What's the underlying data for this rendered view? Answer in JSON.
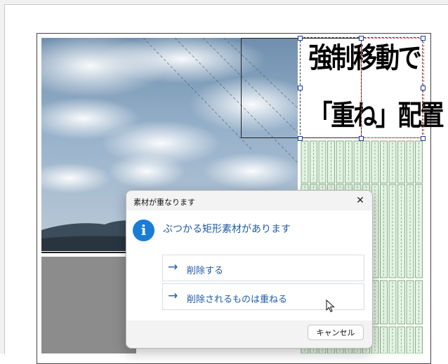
{
  "canvas": {
    "title_lines": [
      "強制移動で",
      "「重ね」配置"
    ]
  },
  "dialog": {
    "title": "素材が重なります",
    "message": "ぶつかる矩形素材があります",
    "options": [
      {
        "arrow": "→",
        "label": "削除する"
      },
      {
        "arrow": "→",
        "label": "削除されるものは重ねる"
      }
    ],
    "cancel_label": "キャンセル",
    "close_glyph": "✕",
    "info_glyph": "i",
    "accent_color": "#1a7cd4"
  }
}
